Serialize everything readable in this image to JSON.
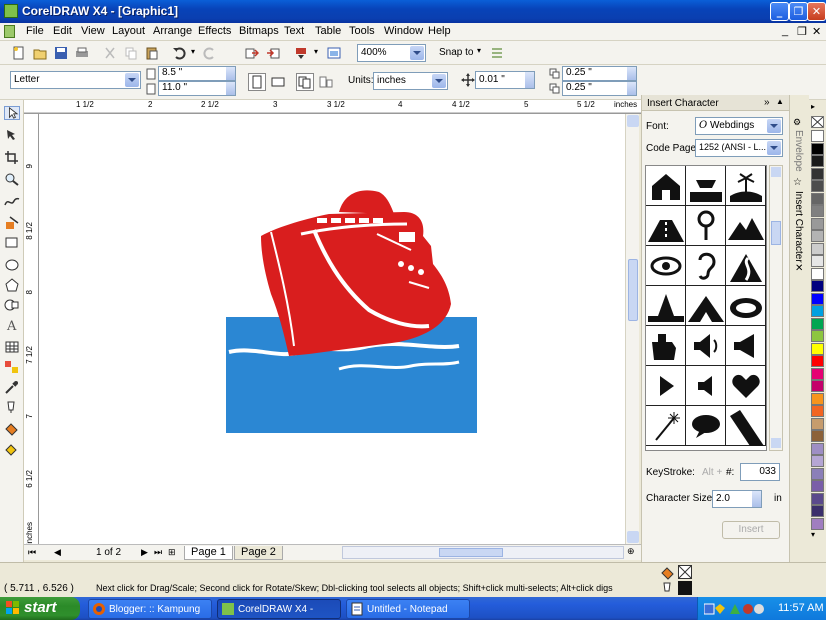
{
  "window": {
    "title": "CorelDRAW X4 - [Graphic1]"
  },
  "menu": [
    "File",
    "Edit",
    "View",
    "Layout",
    "Arrange",
    "Effects",
    "Bitmaps",
    "Text",
    "Table",
    "Tools",
    "Window",
    "Help"
  ],
  "toolbar": {
    "zoom": "400%",
    "snap_to": "Snap to"
  },
  "property_bar": {
    "paper": "Letter",
    "width": "8.5 \"",
    "height": "11.0 \"",
    "units_label": "Units:",
    "units": "inches",
    "nudge": "0.01 \"",
    "dup_x": "0.25 \"",
    "dup_y": "0.25 \""
  },
  "ruler": {
    "h_labels": [
      "1 1/2",
      "2",
      "2 1/2",
      "3",
      "3 1/2",
      "4",
      "4 1/2",
      "5",
      "5 1/2",
      "inches"
    ],
    "v_labels": [
      "9",
      "8 1/2",
      "8",
      "7 1/2",
      "7",
      "6 1/2",
      "inches"
    ]
  },
  "page_nav": {
    "page_count": "1 of 2",
    "tabs": [
      "Page 1",
      "Page 2"
    ]
  },
  "docker": {
    "title": "Insert Character",
    "font_label": "Font:",
    "font": "Webdings",
    "codepage_label": "Code Page:",
    "codepage": "1252  (ANSI - L...",
    "keystroke_label": "KeyStroke:",
    "keystroke_alt": "Alt +",
    "hash_label": "#:",
    "keystroke_value": "033",
    "char_size_label": "Character Size:",
    "char_size": "2.0",
    "char_size_unit": "in",
    "insert_button": "Insert",
    "glyphs": [
      "house-icon",
      "boat-shore-icon",
      "palm-island-icon",
      "road-icon",
      "magnifier-icon",
      "mountain-icon",
      "eye-icon",
      "ear-icon",
      "river-icon",
      "tree-icon",
      "tent-icon",
      "stadium-icon",
      "ship-icon",
      "loudspeaker-icon",
      "megaphone-icon",
      "play-icon",
      "speaker-icon",
      "heart-icon",
      "sparkler-icon",
      "speech-bubble-icon",
      "pen-icon"
    ]
  },
  "docker_tabs": [
    "Envelope",
    "Insert Character"
  ],
  "palette": [
    "#ffffff",
    "#000000",
    "#1a1a1a",
    "#333333",
    "#4d4d4d",
    "#666666",
    "#808080",
    "#999999",
    "#b3b3b3",
    "#cccccc",
    "#e6e6e6",
    "#ffffff",
    "#00007f",
    "#0000ff",
    "#00a0e0",
    "#00a651",
    "#8dc63f",
    "#ffff00",
    "#ff0000",
    "#e60073",
    "#c4006a",
    "#f7941d",
    "#f26522",
    "#c69c6d",
    "#8c6239",
    "#9e8ec4",
    "#b5a6d4",
    "#8b7fb8",
    "#7a5ea8",
    "#5b4a8c",
    "#3b2f6b",
    "#a07ec0"
  ],
  "status": {
    "coords": "( 5.711 , 6.526 )",
    "message": "Next click for Drag/Scale; Second click for Rotate/Skew; Dbl-clicking tool selects all objects; Shift+click multi-selects; Alt+click digs"
  },
  "taskbar": {
    "start": "start",
    "items": [
      "Blogger: :: Kampung ...",
      "CorelDRAW X4 - [Gra...",
      "Untitled - Notepad"
    ],
    "time": "11:57 AM"
  },
  "colors": {
    "ship_red": "#d91e1e",
    "water_blue": "#2b87d3",
    "title_blue": "#0a4fc8"
  }
}
